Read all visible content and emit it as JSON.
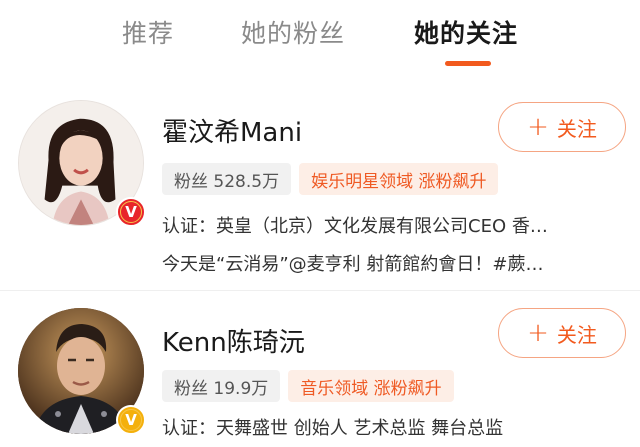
{
  "tabs": [
    {
      "label": "推荐",
      "active": false
    },
    {
      "label": "她的粉丝",
      "active": false
    },
    {
      "label": "她的关注",
      "active": true
    }
  ],
  "accent_color": "#f25a1e",
  "users": [
    {
      "name": "霍汶希Mani",
      "avatar_icon": "female-portrait-avatar",
      "verified_badge": "V",
      "verified_color": "#e8252a",
      "fans_label": "粉丝 528.5万",
      "domain_tag": "娱乐明星领域 涨粉飙升",
      "certification": "认证：英皇（北京）文化发展有限公司CEO 香…",
      "recent_post": "今天是“云消易”@麦亨利 射箭館約會日！#蕨…",
      "follow_label": "关注",
      "follow_icon": "plus-icon"
    },
    {
      "name": "Kenn陈琦沅",
      "avatar_icon": "male-portrait-avatar",
      "verified_badge": "V",
      "verified_color": "#f4b00c",
      "fans_label": "粉丝 19.9万",
      "domain_tag": "音乐领域 涨粉飙升",
      "certification": "认证：天舞盛世 创始人 艺术总监 舞台总监",
      "follow_label": "关注",
      "follow_icon": "plus-icon"
    }
  ]
}
